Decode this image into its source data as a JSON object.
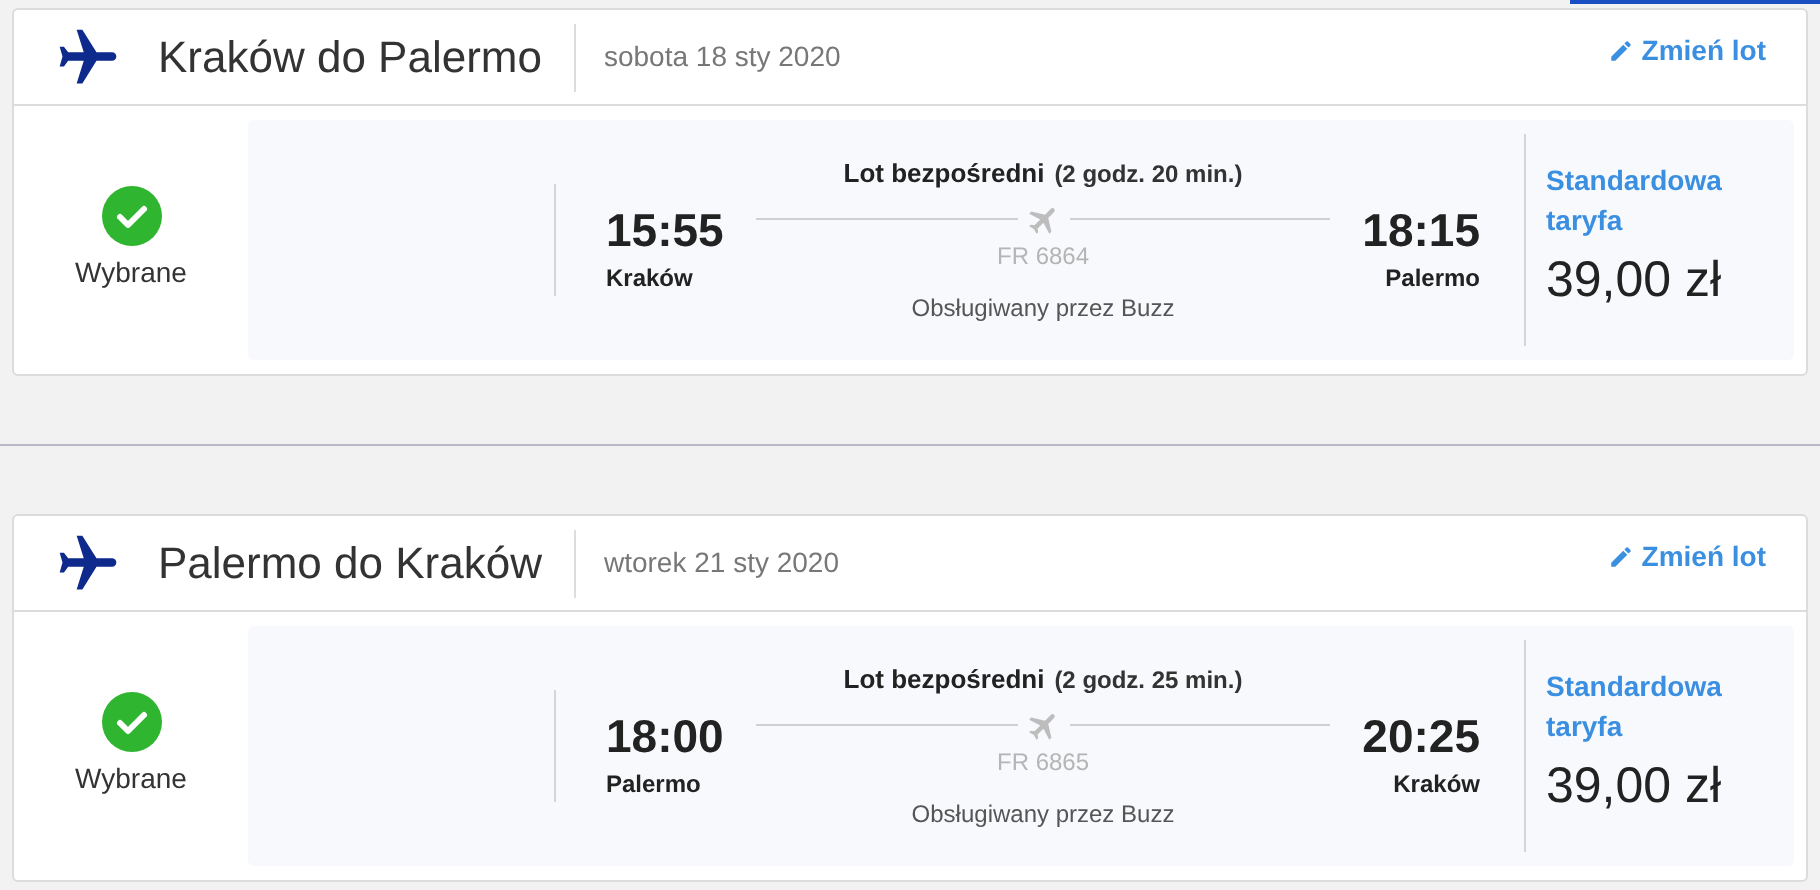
{
  "flights": [
    {
      "route": "Kraków do Palermo",
      "date": "sobota 18 sty 2020",
      "change_link": "Zmień lot",
      "selected": true,
      "status": "Wybrane",
      "type_label": "Lot bezpośredni",
      "duration": "(2 godz. 20 min.)",
      "departure_time": "15:55",
      "departure_city": "Kraków",
      "arrival_time": "18:15",
      "arrival_city": "Palermo",
      "flight_number": "FR 6864",
      "operator": "Obsługiwany przez Buzz",
      "fare_name": "Standardowa taryfa",
      "price": "39,00 zł"
    },
    {
      "route": "Palermo do Kraków",
      "date": "wtorek 21 sty 2020",
      "change_link": "Zmień lot",
      "selected": true,
      "status": "Wybrane",
      "type_label": "Lot bezpośredni",
      "duration": "(2 godz. 25 min.)",
      "departure_time": "18:00",
      "departure_city": "Palermo",
      "arrival_time": "20:25",
      "arrival_city": "Kraków",
      "flight_number": "FR 6865",
      "operator": "Obsługiwany przez Buzz",
      "fare_name": "Standardowa taryfa",
      "price": "39,00 zł"
    }
  ]
}
